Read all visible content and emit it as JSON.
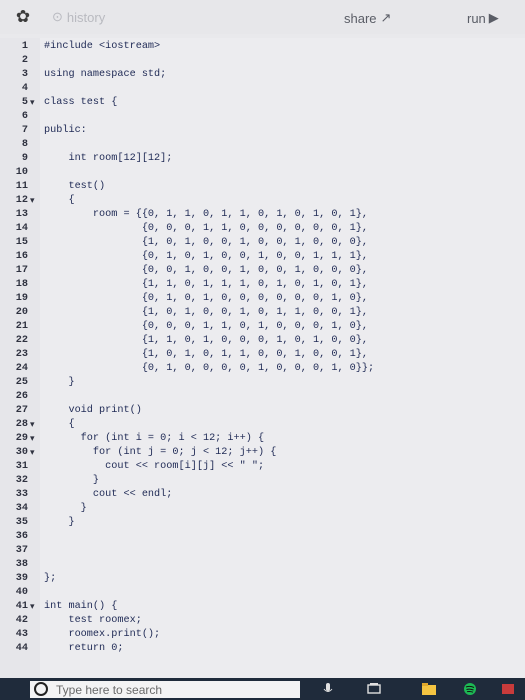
{
  "toolbar": {
    "settings_icon": "gear-icon",
    "history_label": "history",
    "share_label": "share",
    "run_label": "run"
  },
  "code_lines": [
    {
      "n": "1",
      "fold": "",
      "text": "#include <iostream>"
    },
    {
      "n": "2",
      "fold": "",
      "text": ""
    },
    {
      "n": "3",
      "fold": "",
      "text": "using namespace std;"
    },
    {
      "n": "4",
      "fold": "",
      "text": ""
    },
    {
      "n": "5",
      "fold": "▾",
      "text": "class test {"
    },
    {
      "n": "6",
      "fold": "",
      "text": ""
    },
    {
      "n": "7",
      "fold": "",
      "text": "public:"
    },
    {
      "n": "8",
      "fold": "",
      "text": ""
    },
    {
      "n": "9",
      "fold": "",
      "text": "    int room[12][12];"
    },
    {
      "n": "10",
      "fold": "",
      "text": ""
    },
    {
      "n": "11",
      "fold": "",
      "text": "    test()"
    },
    {
      "n": "12",
      "fold": "▾",
      "text": "    {"
    },
    {
      "n": "13",
      "fold": "",
      "text": "        room = {{0, 1, 1, 0, 1, 1, 0, 1, 0, 1, 0, 1},"
    },
    {
      "n": "14",
      "fold": "",
      "text": "                {0, 0, 0, 1, 1, 0, 0, 0, 0, 0, 0, 1},"
    },
    {
      "n": "15",
      "fold": "",
      "text": "                {1, 0, 1, 0, 0, 1, 0, 0, 1, 0, 0, 0},"
    },
    {
      "n": "16",
      "fold": "",
      "text": "                {0, 1, 0, 1, 0, 0, 1, 0, 0, 1, 1, 1},"
    },
    {
      "n": "17",
      "fold": "",
      "text": "                {0, 0, 1, 0, 0, 1, 0, 0, 1, 0, 0, 0},"
    },
    {
      "n": "18",
      "fold": "",
      "text": "                {1, 1, 0, 1, 1, 1, 0, 1, 0, 1, 0, 1},"
    },
    {
      "n": "19",
      "fold": "",
      "text": "                {0, 1, 0, 1, 0, 0, 0, 0, 0, 0, 1, 0},"
    },
    {
      "n": "20",
      "fold": "",
      "text": "                {1, 0, 1, 0, 0, 1, 0, 1, 1, 0, 0, 1},"
    },
    {
      "n": "21",
      "fold": "",
      "text": "                {0, 0, 0, 1, 1, 0, 1, 0, 0, 0, 1, 0},"
    },
    {
      "n": "22",
      "fold": "",
      "text": "                {1, 1, 0, 1, 0, 0, 0, 1, 0, 1, 0, 0},"
    },
    {
      "n": "23",
      "fold": "",
      "text": "                {1, 0, 1, 0, 1, 1, 0, 0, 1, 0, 0, 1},"
    },
    {
      "n": "24",
      "fold": "",
      "text": "                {0, 1, 0, 0, 0, 0, 1, 0, 0, 0, 1, 0}};"
    },
    {
      "n": "25",
      "fold": "",
      "text": "    }"
    },
    {
      "n": "26",
      "fold": "",
      "text": ""
    },
    {
      "n": "27",
      "fold": "",
      "text": "    void print()"
    },
    {
      "n": "28",
      "fold": "▾",
      "text": "    {"
    },
    {
      "n": "29",
      "fold": "▾",
      "text": "      for (int i = 0; i < 12; i++) {"
    },
    {
      "n": "30",
      "fold": "▾",
      "text": "        for (int j = 0; j < 12; j++) {"
    },
    {
      "n": "31",
      "fold": "",
      "text": "          cout << room[i][j] << \" \";"
    },
    {
      "n": "32",
      "fold": "",
      "text": "        }"
    },
    {
      "n": "33",
      "fold": "",
      "text": "        cout << endl;"
    },
    {
      "n": "34",
      "fold": "",
      "text": "      }"
    },
    {
      "n": "35",
      "fold": "",
      "text": "    }"
    },
    {
      "n": "36",
      "fold": "",
      "text": ""
    },
    {
      "n": "37",
      "fold": "",
      "text": ""
    },
    {
      "n": "38",
      "fold": "",
      "text": ""
    },
    {
      "n": "39",
      "fold": "",
      "text": "};"
    },
    {
      "n": "40",
      "fold": "",
      "text": ""
    },
    {
      "n": "41",
      "fold": "▾",
      "text": "int main() {"
    },
    {
      "n": "42",
      "fold": "",
      "text": "    test roomex;"
    },
    {
      "n": "43",
      "fold": "",
      "text": "    roomex.print();"
    },
    {
      "n": "44",
      "fold": "",
      "text": "    return 0;"
    }
  ],
  "taskbar": {
    "search_placeholder": "Type here to search"
  }
}
